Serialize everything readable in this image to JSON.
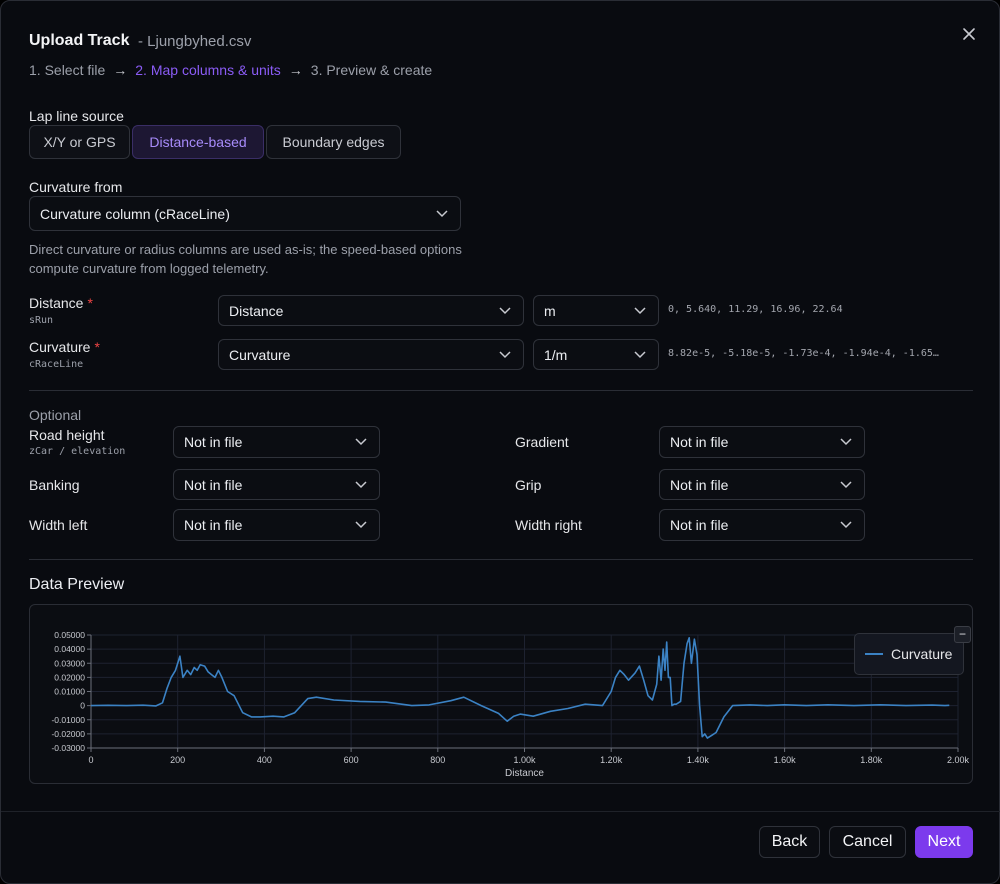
{
  "dialog": {
    "title": "Upload Track",
    "filename": "- Ljungbyhed.csv",
    "steps": [
      "1. Select file",
      "2. Map columns & units",
      "3. Preview & create"
    ]
  },
  "lap_line": {
    "label": "Lap line source",
    "options": [
      "X/Y or GPS",
      "Distance-based",
      "Boundary edges"
    ],
    "selected": "Distance-based"
  },
  "curvature_from": {
    "label": "Curvature from",
    "value": "Curvature column (cRaceLine)",
    "help": "Direct curvature or radius columns are used as-is; the speed-based options compute curvature from logged telemetry."
  },
  "required": [
    {
      "label": "Distance",
      "required_mark": "*",
      "source": "sRun",
      "column": "Distance",
      "unit": "m",
      "sample": "0, 5.640, 11.29, 16.96, 22.64"
    },
    {
      "label": "Curvature",
      "required_mark": "*",
      "source": "cRaceLine",
      "column": "Curvature",
      "unit": "1/m",
      "sample": "8.82e-5, -5.18e-5, -1.73e-4, -1.94e-4, -1.65…"
    }
  ],
  "optional": {
    "heading": "Optional",
    "fields": [
      {
        "label": "Road height",
        "source": "zCar / elevation",
        "value": "Not in file"
      },
      {
        "label": "Gradient",
        "value": "Not in file"
      },
      {
        "label": "Banking",
        "value": "Not in file"
      },
      {
        "label": "Grip",
        "value": "Not in file"
      },
      {
        "label": "Width left",
        "value": "Not in file"
      },
      {
        "label": "Width right",
        "value": "Not in file"
      }
    ]
  },
  "preview": {
    "heading": "Data Preview",
    "legend_toggle": "−"
  },
  "chart_data": {
    "type": "line",
    "xlabel": "Distance",
    "ylabel": "",
    "xlim": [
      0,
      2000
    ],
    "ylim": [
      -0.03,
      0.05
    ],
    "x_ticks": [
      0,
      200,
      400,
      600,
      800,
      1000,
      1200,
      1400,
      1600,
      1800,
      2000
    ],
    "x_tick_labels": [
      "0",
      "200",
      "400",
      "600",
      "800",
      "1.00k",
      "1.20k",
      "1.40k",
      "1.60k",
      "1.80k",
      "2.00k"
    ],
    "y_ticks": [
      0.05,
      0.04,
      0.03,
      0.02,
      0.01,
      0,
      -0.01,
      -0.02,
      -0.03
    ],
    "y_tick_labels": [
      "0.05000",
      "0.04000",
      "0.03000",
      "0.02000",
      "0.01000",
      "0",
      "-0.01000",
      "-0.02000",
      "-0.03000"
    ],
    "grid": true,
    "legend": "top-right",
    "color": "#3b82c4",
    "series": [
      {
        "name": "Curvature",
        "x": [
          0,
          40,
          80,
          120,
          150,
          165,
          175,
          185,
          195,
          205,
          212,
          222,
          230,
          238,
          245,
          252,
          262,
          270,
          278,
          286,
          294,
          302,
          315,
          330,
          350,
          370,
          390,
          420,
          445,
          470,
          500,
          520,
          560,
          620,
          680,
          740,
          780,
          830,
          860,
          900,
          940,
          960,
          975,
          990,
          1020,
          1060,
          1100,
          1140,
          1180,
          1200,
          1210,
          1220,
          1230,
          1240,
          1255,
          1265,
          1275,
          1285,
          1295,
          1305,
          1310,
          1315,
          1320,
          1324,
          1328,
          1332,
          1336,
          1340,
          1345,
          1350,
          1360,
          1368,
          1375,
          1380,
          1385,
          1392,
          1398,
          1404,
          1410,
          1416,
          1422,
          1432,
          1442,
          1460,
          1480,
          1520,
          1560,
          1600,
          1650,
          1700,
          1760,
          1820,
          1880,
          1940,
          1970,
          1980
        ],
        "y": [
          0.0,
          0.0002,
          0.0,
          0.0003,
          -0.0002,
          0.002,
          0.012,
          0.02,
          0.025,
          0.035,
          0.02,
          0.025,
          0.022,
          0.027,
          0.025,
          0.029,
          0.028,
          0.024,
          0.022,
          0.02,
          0.025,
          0.02,
          0.01,
          0.007,
          -0.005,
          -0.008,
          -0.008,
          -0.0075,
          -0.008,
          -0.005,
          0.005,
          0.006,
          0.004,
          0.003,
          0.0025,
          0.0,
          0.0005,
          0.0035,
          0.006,
          0.0,
          -0.0055,
          -0.011,
          -0.0075,
          -0.006,
          -0.0075,
          -0.004,
          -0.002,
          0.001,
          0.0,
          0.01,
          0.02,
          0.025,
          0.022,
          0.018,
          0.023,
          0.028,
          0.018,
          0.007,
          0.004,
          0.015,
          0.035,
          0.018,
          0.04,
          0.025,
          0.045,
          0.02,
          0.02,
          0.0,
          0.001,
          0.001,
          0.003,
          0.03,
          0.044,
          0.048,
          0.03,
          0.047,
          0.036,
          0.0,
          -0.022,
          -0.02,
          -0.023,
          -0.021,
          -0.019,
          -0.008,
          0.0,
          0.0005,
          0.0,
          0.0006,
          0.0,
          0.0006,
          0.0,
          0.0006,
          0.0,
          0.0004,
          0.0,
          0.0002
        ]
      }
    ]
  },
  "footer": {
    "back": "Back",
    "cancel": "Cancel",
    "next": "Next"
  }
}
